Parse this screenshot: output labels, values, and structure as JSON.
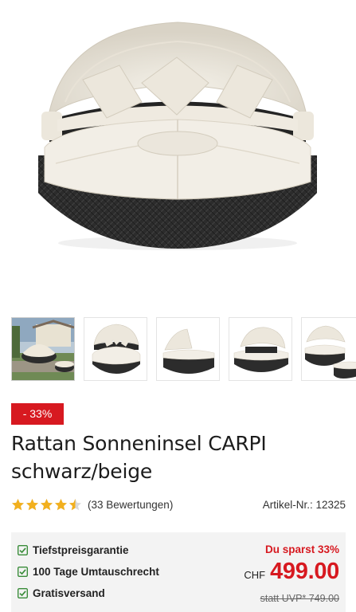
{
  "product": {
    "discount_badge": "- 33%",
    "title": "Rattan Sonneninsel CARPI schwarz/beige",
    "rating_value": 4.5,
    "rating_max": 5,
    "reviews_text": "(33 Bewertungen)",
    "article_number_text": "Artikel-Nr.: 12325"
  },
  "gallery": {
    "thumbnails": [
      {
        "icon": "outdoor-scene-thumbnail"
      },
      {
        "icon": "front-view-thumbnail"
      },
      {
        "icon": "folded-view-thumbnail"
      },
      {
        "icon": "side-view-thumbnail"
      },
      {
        "icon": "split-view-thumbnail"
      }
    ]
  },
  "benefits": [
    "Tiefstpreisgarantie",
    "100 Tage Umtauschrecht",
    "Gratisversand"
  ],
  "pricing": {
    "savings_text": "Du sparst 33%",
    "currency": "CHF",
    "price": "499.00",
    "old_price_text": "statt UVP* 749.00"
  },
  "colors": {
    "accent_red": "#d71920",
    "star_gold": "#f2b01e",
    "check_green": "#3a8c3a",
    "panel_bg": "#f3f3f3"
  }
}
